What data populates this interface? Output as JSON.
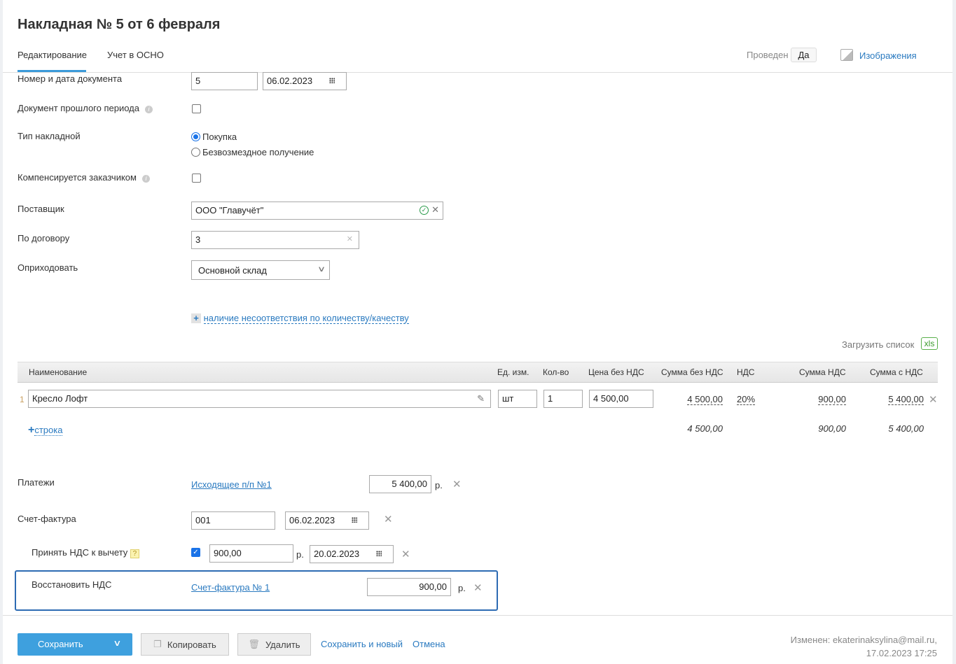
{
  "title": "Накладная № 5 от 6 февраля",
  "tabs": [
    {
      "label": "Редактирование"
    },
    {
      "label": "Учет в ОСНО"
    }
  ],
  "header": {
    "posted_label": "Проведен",
    "posted_value": "Да",
    "images_label": "Изображения"
  },
  "form": {
    "doc_label": "Номер и дата документа",
    "doc_number": "5",
    "doc_date": "06.02.2023",
    "past_label": "Документ прошлого периода",
    "type_label": "Тип накладной",
    "type_options": [
      "Покупка",
      "Безвозмездное получение"
    ],
    "compensated_label": "Компенсируется заказчиком",
    "supplier_label": "Поставщик",
    "supplier_value": "ООО \"Главучёт\"",
    "contract_label": "По договору",
    "contract_value": "3",
    "store_label": "Оприходовать",
    "store_value": "Основной склад",
    "mismatch_link": "наличие несоответствия по количеству/качеству"
  },
  "upload": {
    "label": "Загрузить список",
    "badge": "xls"
  },
  "table": {
    "headers": [
      "Наименование",
      "Ед. изм.",
      "Кол-во",
      "Цена без НДС",
      "Сумма без НДС",
      "НДС",
      "Сумма НДС",
      "Сумма с НДС"
    ],
    "rows": [
      {
        "n": "1",
        "name": "Кресло Лофт",
        "unit": "шт",
        "qty": "1",
        "price": "4 500,00",
        "sum": "4 500,00",
        "vat": "20%",
        "vat_sum": "900,00",
        "total": "5 400,00"
      }
    ],
    "add_row": "строка",
    "totals": {
      "sum": "4 500,00",
      "vat_sum": "900,00",
      "total": "5 400,00"
    }
  },
  "payments": {
    "label": "Платежи",
    "link": "Исходящее п/п №1",
    "amount": "5 400,00",
    "currency": "р."
  },
  "invoice": {
    "label": "Счет-фактура",
    "number": "001",
    "date": "06.02.2023"
  },
  "vat_deduct": {
    "label": "Принять НДС к вычету",
    "help": "?",
    "amount": "900,00",
    "currency": "р.",
    "date": "20.02.2023"
  },
  "vat_restore": {
    "label": "Восстановить НДС",
    "link": "Счет-фактура № 1",
    "amount": "900,00",
    "currency": "р."
  },
  "footer": {
    "save": "Сохранить",
    "copy": "Копировать",
    "delete": "Удалить",
    "save_new": "Сохранить и новый",
    "cancel": "Отмена",
    "modified": "Изменен: ekaterinaksylina@mail.ru,",
    "modified_date": "17.02.2023 17:25"
  }
}
